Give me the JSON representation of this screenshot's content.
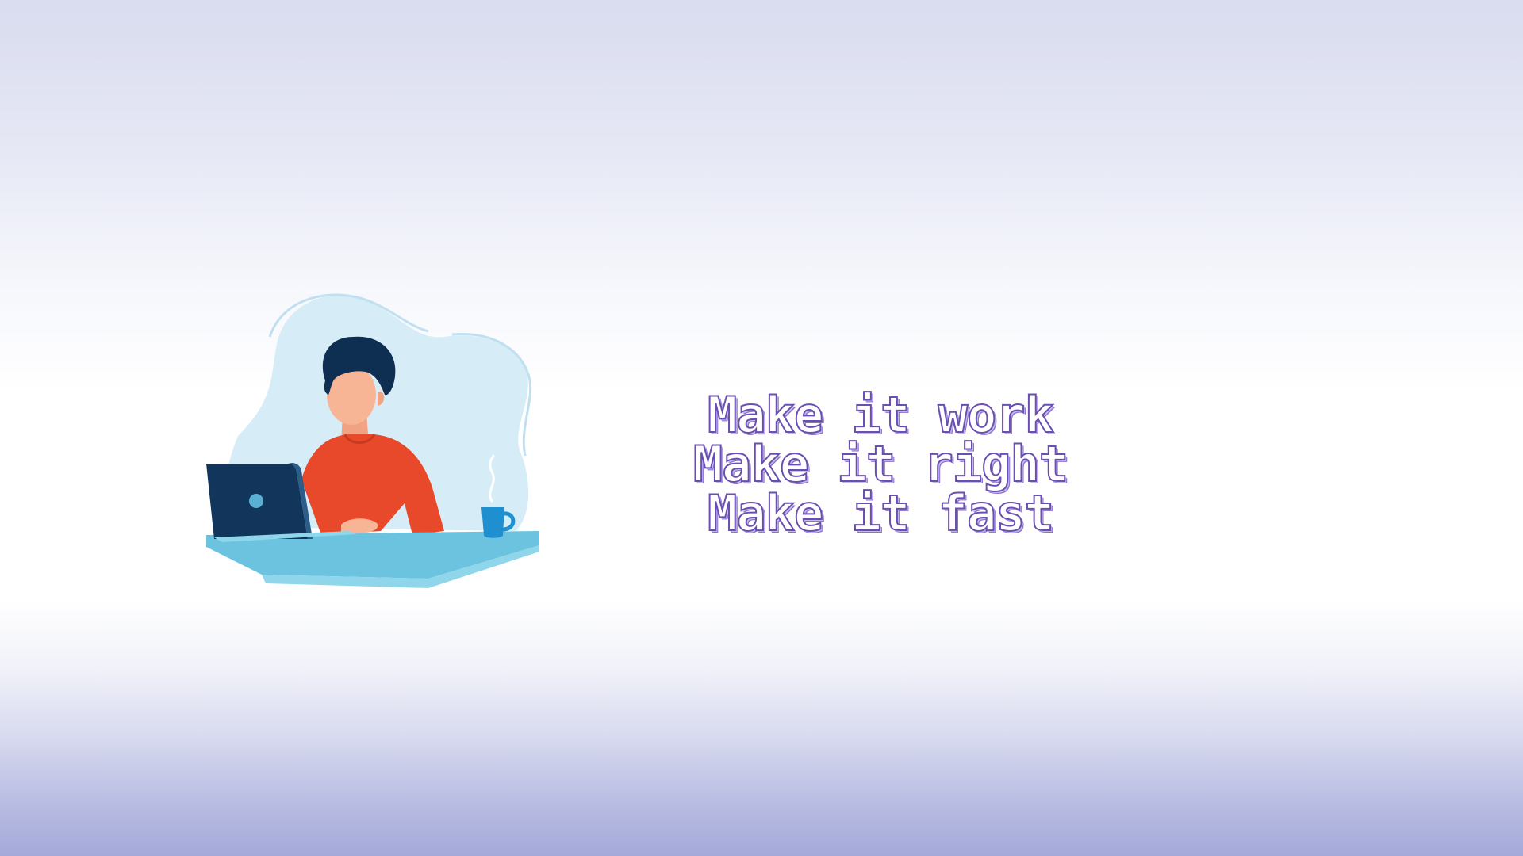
{
  "motto": {
    "line1": "Make it work",
    "line2": "Make it right",
    "line3": "Make it fast",
    "text_color": "#ffffff",
    "outline_color": "#6a4fb2"
  },
  "illustration": {
    "subject": "person-working-on-laptop",
    "colors": {
      "blob": "#d6ecf7",
      "blob_outline": "#bfe0f1",
      "desk": "#6cc3e0",
      "desk_front": "#8fd6ea",
      "laptop": "#12355b",
      "shirt": "#e8492a",
      "skin": "#f7b596",
      "hair": "#0f2f52",
      "mug": "#1f8fd0"
    }
  }
}
